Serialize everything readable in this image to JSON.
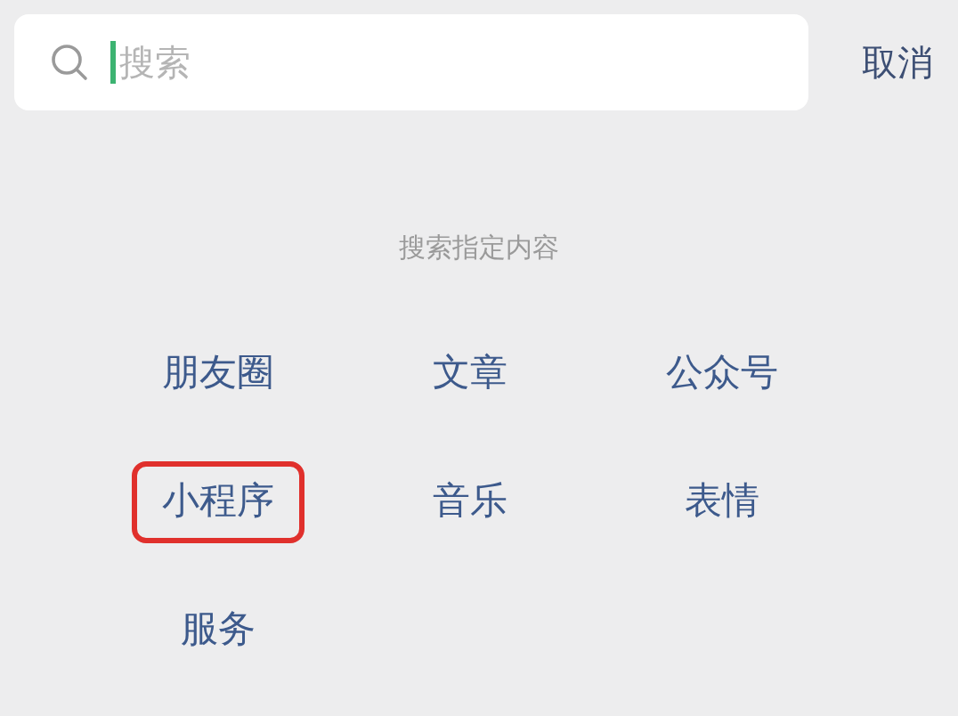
{
  "search": {
    "placeholder": "搜索",
    "focused": true
  },
  "cancel": "取消",
  "section_title": "搜索指定内容",
  "categories": [
    {
      "label": "朋友圈",
      "highlighted": false
    },
    {
      "label": "文章",
      "highlighted": false
    },
    {
      "label": "公众号",
      "highlighted": false
    },
    {
      "label": "小程序",
      "highlighted": true
    },
    {
      "label": "音乐",
      "highlighted": false
    },
    {
      "label": "表情",
      "highlighted": false
    },
    {
      "label": "服务",
      "highlighted": false
    }
  ]
}
